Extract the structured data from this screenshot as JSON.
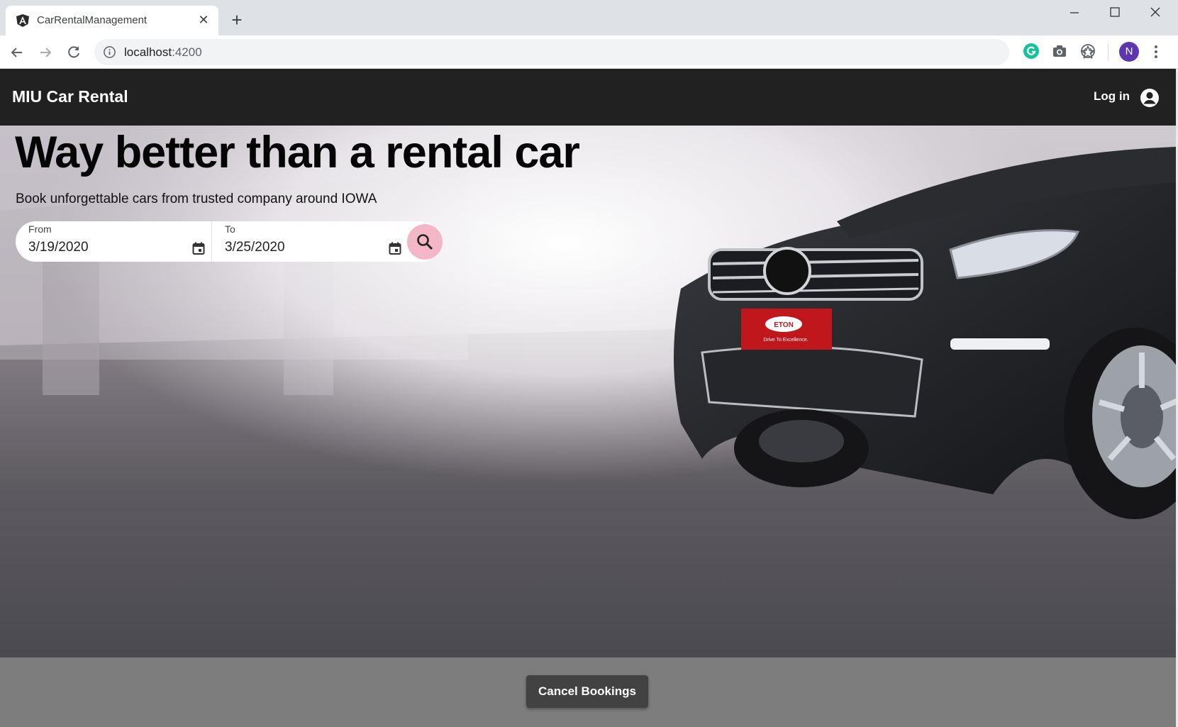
{
  "browser": {
    "tab_title": "CarRentalManagement",
    "tab_close": "✕",
    "new_tab": "+",
    "url_host": "localhost",
    "url_port": ":4200",
    "profile_initial": "N"
  },
  "header": {
    "brand": "MIU Car Rental",
    "login_label": "Log in"
  },
  "hero": {
    "headline": "Way better than a rental car",
    "subline": "Book unforgettable cars from trusted company around IOWA",
    "plate_text": "ETON",
    "plate_tagline": "Drive To Excellence."
  },
  "search": {
    "from_label": "From",
    "from_value": "3/19/2020",
    "to_label": "To",
    "to_value": "3/25/2020"
  },
  "footer": {
    "cancel_label": "Cancel Bookings"
  },
  "colors": {
    "header_bg": "#212121",
    "search_button": "#f4b7c7",
    "footer_bg": "#7d7d7d",
    "cancel_button": "#424242",
    "profile": "#5e35b1"
  }
}
